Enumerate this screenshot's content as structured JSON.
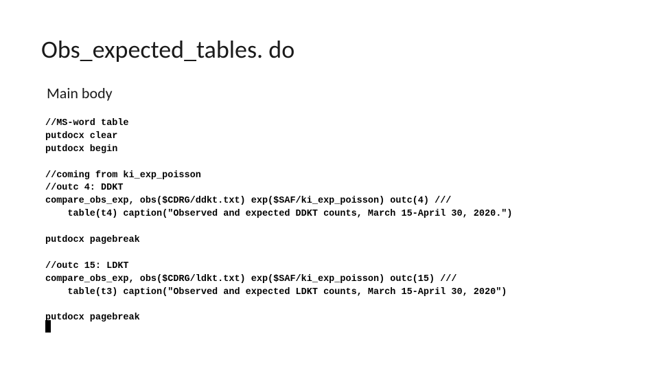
{
  "title": "Obs_expected_tables. do",
  "subtitle": "Main body",
  "code_lines": {
    "l1": "//MS-word table",
    "l2": "putdocx clear",
    "l3": "putdocx begin",
    "l4": "",
    "l5": "//coming from ki_exp_poisson",
    "l6": "//outc 4: DDKT",
    "l7": "compare_obs_exp, obs($CDRG/ddkt.txt) exp($SAF/ki_exp_poisson) outc(4) ///",
    "l8": "    table(t4) caption(\"Observed and expected DDKT counts, March 15-April 30, 2020.\")",
    "l9": "",
    "l10": "putdocx pagebreak",
    "l11": "",
    "l12": "//outc 15: LDKT",
    "l13": "compare_obs_exp, obs($CDRG/ldkt.txt) exp($SAF/ki_exp_poisson) outc(15) ///",
    "l14": "    table(t3) caption(\"Observed and expected LDKT counts, March 15-April 30, 2020\")",
    "l15": "",
    "l16": "putdocx pagebreak"
  }
}
